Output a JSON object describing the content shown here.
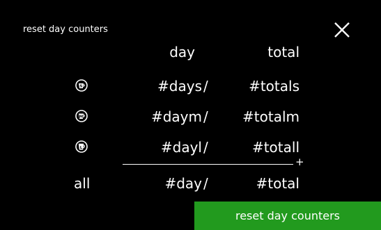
{
  "header": {
    "title": "reset day counters",
    "close_icon": "close-icon"
  },
  "table": {
    "col_day": "day",
    "col_total": "total",
    "separator": "/",
    "rows": [
      {
        "icon": "cup-small-icon",
        "day": "#days",
        "total": "#totals"
      },
      {
        "icon": "cup-medium-icon",
        "day": "#daym",
        "total": "#totalm"
      },
      {
        "icon": "cup-large-icon",
        "day": "#dayl",
        "total": "#totall"
      }
    ],
    "sum_sign": "+",
    "all_row": {
      "label": "all",
      "day": "#day",
      "total": "#total"
    }
  },
  "action": {
    "reset_label": "reset day counters"
  },
  "colors": {
    "background": "#000000",
    "text": "#ffffff",
    "button": "#229a1e"
  }
}
